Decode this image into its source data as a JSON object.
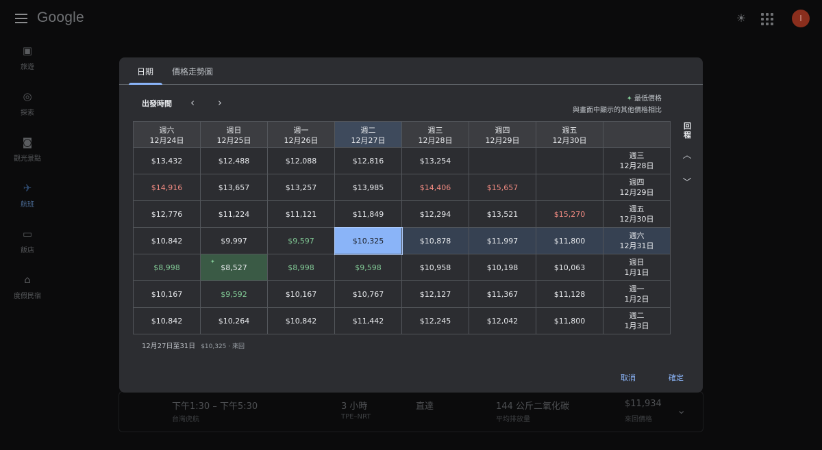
{
  "app": {
    "logo": "Google",
    "avatar_letter": "I"
  },
  "sidebar": {
    "items": [
      {
        "label": "旅遊",
        "icon": "luggage-icon"
      },
      {
        "label": "探索",
        "icon": "explore-icon"
      },
      {
        "label": "觀光景點",
        "icon": "camera-icon"
      },
      {
        "label": "航班",
        "icon": "flight-icon"
      },
      {
        "label": "飯店",
        "icon": "hotel-icon"
      },
      {
        "label": "度假民宿",
        "icon": "house-icon"
      }
    ]
  },
  "background_flight": {
    "time": "下午1:30 – 下午5:30",
    "airline": "台灣虎航",
    "duration": "3 小時",
    "route": "TPE–NRT",
    "stops": "直達",
    "emissions": "144 公斤二氧化碳",
    "emissions_sub": "平均排放量",
    "price": "$11,934",
    "price_sub": "來回價格"
  },
  "dialog": {
    "tabs": [
      {
        "label": "日期"
      },
      {
        "label": "價格走勢圖"
      }
    ],
    "depart_label": "出發時間",
    "legend_title": "最低價格",
    "legend_sub": "與畫面中顯示的其他價格相比",
    "return_label": "回程",
    "columns": [
      {
        "day": "週六",
        "date": "12月24日"
      },
      {
        "day": "週日",
        "date": "12月25日"
      },
      {
        "day": "週一",
        "date": "12月26日"
      },
      {
        "day": "週二",
        "date": "12月27日"
      },
      {
        "day": "週三",
        "date": "12月28日"
      },
      {
        "day": "週四",
        "date": "12月29日"
      },
      {
        "day": "週五",
        "date": "12月30日"
      }
    ],
    "rows": [
      {
        "day": "週三",
        "date": "12月28日",
        "cells": [
          {
            "v": "$13,432"
          },
          {
            "v": "$12,488"
          },
          {
            "v": "$12,088"
          },
          {
            "v": "$12,816"
          },
          {
            "v": "$13,254"
          },
          {
            "v": ""
          },
          {
            "v": ""
          }
        ]
      },
      {
        "day": "週四",
        "date": "12月29日",
        "cells": [
          {
            "v": "$14,916",
            "k": "high"
          },
          {
            "v": "$13,657"
          },
          {
            "v": "$13,257"
          },
          {
            "v": "$13,985"
          },
          {
            "v": "$14,406",
            "k": "high"
          },
          {
            "v": "$15,657",
            "k": "high"
          },
          {
            "v": ""
          }
        ]
      },
      {
        "day": "週五",
        "date": "12月30日",
        "cells": [
          {
            "v": "$12,776"
          },
          {
            "v": "$11,224"
          },
          {
            "v": "$11,121"
          },
          {
            "v": "$11,849"
          },
          {
            "v": "$12,294"
          },
          {
            "v": "$13,521"
          },
          {
            "v": "$15,270",
            "k": "high"
          }
        ]
      },
      {
        "day": "週六",
        "date": "12月31日",
        "cells": [
          {
            "v": "$10,842"
          },
          {
            "v": "$9,997"
          },
          {
            "v": "$9,597",
            "k": "low"
          },
          {
            "v": "$10,325",
            "k": "sel"
          },
          {
            "v": "$10,878"
          },
          {
            "v": "$11,997"
          },
          {
            "v": "$11,800"
          }
        ]
      },
      {
        "day": "週日",
        "date": "1月1日",
        "cells": [
          {
            "v": "$8,998",
            "k": "low"
          },
          {
            "v": "$8,527",
            "k": "cheapest"
          },
          {
            "v": "$8,998",
            "k": "low"
          },
          {
            "v": "$9,598",
            "k": "low"
          },
          {
            "v": "$10,958"
          },
          {
            "v": "$10,198"
          },
          {
            "v": "$10,063"
          }
        ]
      },
      {
        "day": "週一",
        "date": "1月2日",
        "cells": [
          {
            "v": "$10,167"
          },
          {
            "v": "$9,592",
            "k": "low"
          },
          {
            "v": "$10,167"
          },
          {
            "v": "$10,767"
          },
          {
            "v": "$12,127"
          },
          {
            "v": "$11,367"
          },
          {
            "v": "$11,128"
          }
        ]
      },
      {
        "day": "週二",
        "date": "1月3日",
        "cells": [
          {
            "v": "$10,842"
          },
          {
            "v": "$10,264"
          },
          {
            "v": "$10,842"
          },
          {
            "v": "$11,442"
          },
          {
            "v": "$12,245"
          },
          {
            "v": "$12,042"
          },
          {
            "v": "$11,800"
          }
        ]
      }
    ],
    "selected_col": 3,
    "selected_row": 3,
    "summary_dates": "12月27日至31日",
    "summary_price": "$10,325 · 來回",
    "cancel_label": "取消",
    "confirm_label": "確定"
  },
  "colors": {
    "accent": "#8ab4f8",
    "high_price": "#f28b82",
    "low_price": "#81c995",
    "dialog_bg": "#2c2d31"
  }
}
